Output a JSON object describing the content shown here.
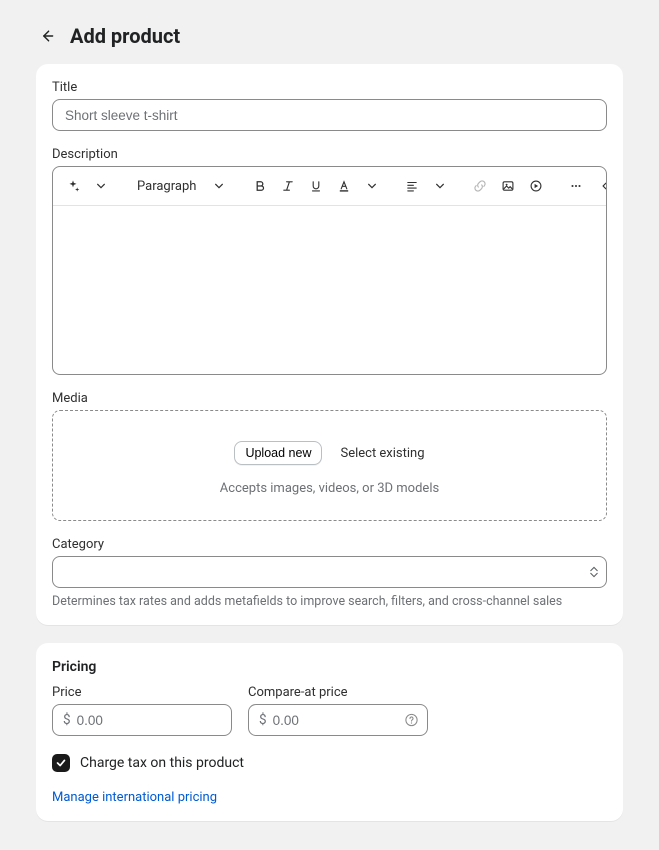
{
  "header": {
    "title": "Add product"
  },
  "product": {
    "title_label": "Title",
    "title_placeholder": "Short sleeve t-shirt",
    "title_value": "",
    "description_label": "Description",
    "rte": {
      "style_label": "Paragraph"
    },
    "media_label": "Media",
    "media_upload_label": "Upload new",
    "media_select_label": "Select existing",
    "media_hint": "Accepts images, videos, or 3D models",
    "category_label": "Category",
    "category_value": "",
    "category_help": "Determines tax rates and adds metafields to improve search, filters, and cross-channel sales"
  },
  "pricing": {
    "section_title": "Pricing",
    "price_label": "Price",
    "price_currency": "$",
    "price_placeholder": "0.00",
    "price_value": "",
    "compare_label": "Compare-at price",
    "compare_currency": "$",
    "compare_placeholder": "0.00",
    "compare_value": "",
    "charge_tax_checked": true,
    "charge_tax_label": "Charge tax on this product",
    "intl_link": "Manage international pricing"
  }
}
